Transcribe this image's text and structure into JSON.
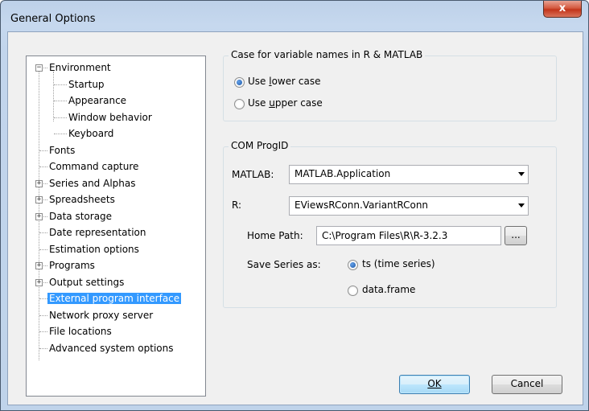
{
  "window": {
    "title": "General Options",
    "close_glyph": "x"
  },
  "tree": {
    "items": [
      {
        "label": "Environment",
        "expander": "−"
      },
      {
        "label": "Startup"
      },
      {
        "label": "Appearance"
      },
      {
        "label": "Window behavior"
      },
      {
        "label": "Keyboard"
      },
      {
        "label": "Fonts"
      },
      {
        "label": "Command capture"
      },
      {
        "label": "Series and Alphas",
        "expander": "+"
      },
      {
        "label": "Spreadsheets",
        "expander": "+"
      },
      {
        "label": "Data storage",
        "expander": "+"
      },
      {
        "label": "Date representation"
      },
      {
        "label": "Estimation options"
      },
      {
        "label": "Programs",
        "expander": "+"
      },
      {
        "label": "Output settings",
        "expander": "+"
      },
      {
        "label": "External program interface",
        "selected": true
      },
      {
        "label": "Network proxy server"
      },
      {
        "label": "File locations"
      },
      {
        "label": "Advanced system options"
      }
    ]
  },
  "case_group": {
    "title": "Case for variable names in R & MATLAB",
    "lower_label": "Use lower case",
    "upper_label": "Use upper case",
    "selected": "lower"
  },
  "com_group": {
    "title": "COM ProgID",
    "matlab_label": "MATLAB:",
    "matlab_value": "MATLAB.Application",
    "r_label": "R:",
    "r_value": "EViewsRConn.VariantRConn",
    "home_path_label": "Home Path:",
    "home_path_value": "C:\\Program Files\\R\\R-3.2.3",
    "browse_label": "...",
    "save_series_label": "Save Series as:",
    "ts_label": "ts (time series)",
    "dataframe_label": "data.frame",
    "selected": "ts"
  },
  "buttons": {
    "ok": "OK",
    "cancel": "Cancel"
  },
  "colors": {
    "selection": "#3399ff",
    "title_gradient": "#bfd3ea",
    "close_button": "#c2351b"
  }
}
